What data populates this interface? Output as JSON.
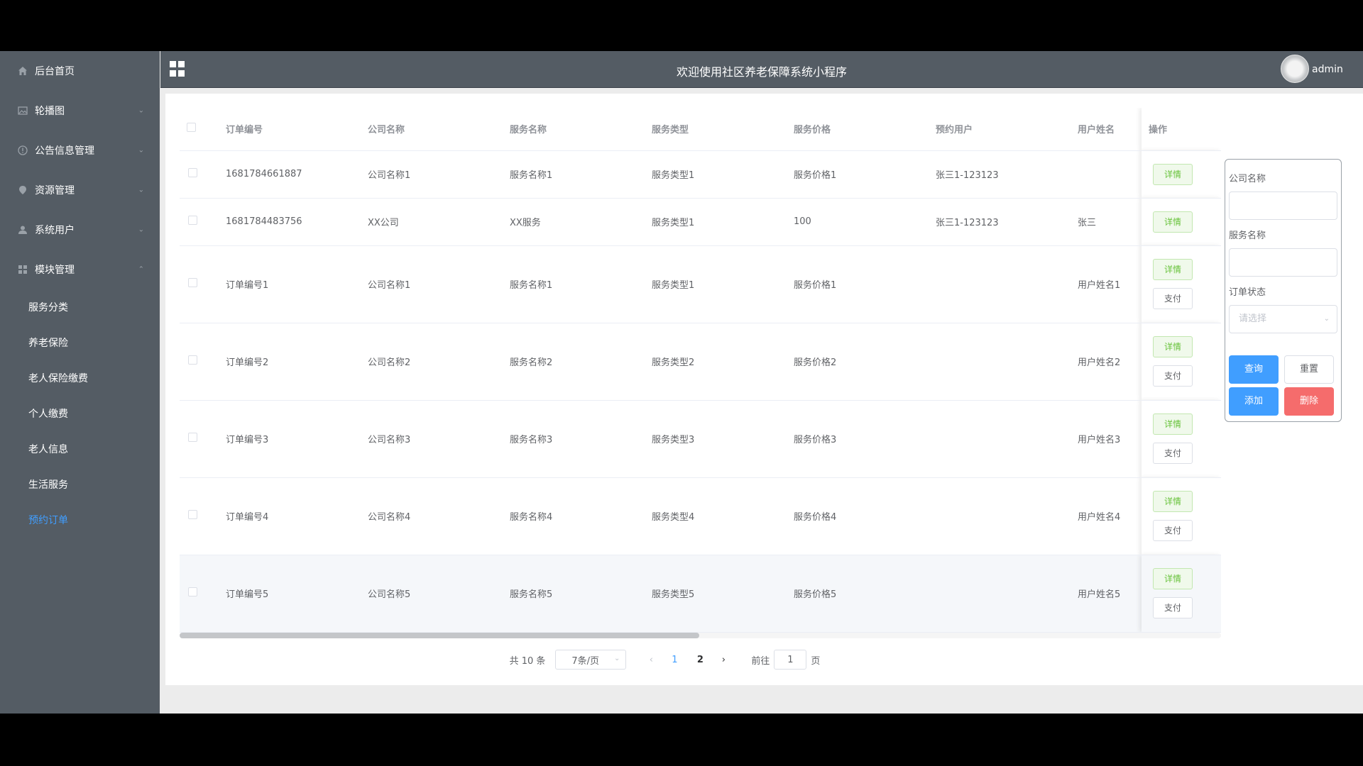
{
  "header": {
    "title": "欢迎使用社区养老保障系统小程序",
    "user": "admin"
  },
  "sidebar": {
    "items": [
      {
        "label": "后台首页",
        "icon": "home-icon"
      },
      {
        "label": "轮播图",
        "icon": "image-icon",
        "chevron": "down"
      },
      {
        "label": "公告信息管理",
        "icon": "info-icon",
        "chevron": "down"
      },
      {
        "label": "资源管理",
        "icon": "pin-icon",
        "chevron": "down"
      },
      {
        "label": "系统用户",
        "icon": "user-icon",
        "chevron": "down"
      },
      {
        "label": "模块管理",
        "icon": "grid-icon",
        "chevron": "up"
      }
    ],
    "sub_items": [
      {
        "label": "服务分类"
      },
      {
        "label": "养老保险"
      },
      {
        "label": "老人保险缴费"
      },
      {
        "label": "个人缴费"
      },
      {
        "label": "老人信息"
      },
      {
        "label": "生活服务"
      },
      {
        "label": "预约订单",
        "active": true
      }
    ]
  },
  "table": {
    "columns": [
      "订单编号",
      "公司名称",
      "服务名称",
      "服务类型",
      "服务价格",
      "预约用户",
      "用户姓名",
      "操作"
    ],
    "rows": [
      [
        "1681784661887",
        "公司名称1",
        "服务名称1",
        "服务类型1",
        "服务价格1",
        "张三1-123123",
        ""
      ],
      [
        "1681784483756",
        "XX公司",
        "XX服务",
        "服务类型1",
        "100",
        "张三1-123123",
        "张三"
      ],
      [
        "订单编号1",
        "公司名称1",
        "服务名称1",
        "服务类型1",
        "服务价格1",
        "",
        "用户姓名1"
      ],
      [
        "订单编号2",
        "公司名称2",
        "服务名称2",
        "服务类型2",
        "服务价格2",
        "",
        "用户姓名2"
      ],
      [
        "订单编号3",
        "公司名称3",
        "服务名称3",
        "服务类型3",
        "服务价格3",
        "",
        "用户姓名3"
      ],
      [
        "订单编号4",
        "公司名称4",
        "服务名称4",
        "服务类型4",
        "服务价格4",
        "",
        "用户姓名4"
      ],
      [
        "订单编号5",
        "公司名称5",
        "服务名称5",
        "服务类型5",
        "服务价格5",
        "",
        "用户姓名5"
      ]
    ],
    "detail_label": "详情",
    "pay_label": "支付"
  },
  "pagination": {
    "total": "共 10 条",
    "page_size": "7条/页",
    "pages": [
      "1",
      "2"
    ],
    "goto_prefix": "前往",
    "goto_value": "1",
    "goto_suffix": "页"
  },
  "search": {
    "company_label": "公司名称",
    "service_label": "服务名称",
    "status_label": "订单状态",
    "status_placeholder": "请选择",
    "query_btn": "查询",
    "reset_btn": "重置",
    "add_btn": "添加",
    "delete_btn": "删除"
  },
  "colors": {
    "sidebar_bg": "#545c64",
    "primary": "#409eff",
    "danger": "#f56c6c",
    "success": "#67c23a"
  }
}
